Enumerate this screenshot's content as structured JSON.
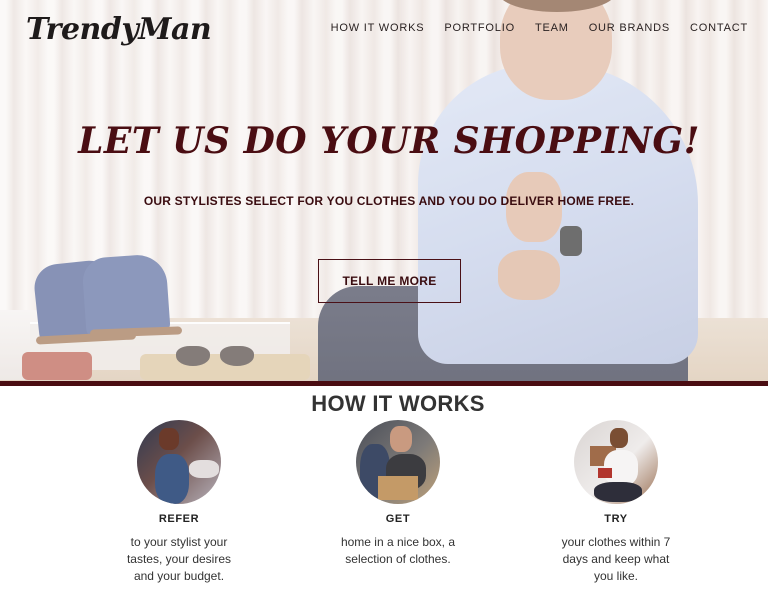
{
  "brand": {
    "logo_text": "TrendyMan"
  },
  "nav": {
    "items": [
      "HOW IT WORKS",
      "PORTFOLIO",
      "TEAM",
      "OUR BRANDS",
      "CONTACT"
    ]
  },
  "hero": {
    "title": "LET US DO YOUR SHOPPING!",
    "subtitle": "OUR STYLISTES SELECT FOR YOU CLOTHES AND YOU DO DELIVER HOME FREE.",
    "cta_label": "TELL ME MORE"
  },
  "how_it_works": {
    "title": "HOW IT WORKS",
    "steps": [
      {
        "title": "REFER",
        "text": "to your stylist your tastes, your desires and your budget."
      },
      {
        "title": "GET",
        "text": "home in a nice box, a selection of clothes."
      },
      {
        "title": "TRY",
        "text": "your clothes within 7 days and keep what you like."
      }
    ]
  },
  "colors": {
    "accent": "#4a0d12",
    "text": "#333333",
    "background": "#ffffff"
  }
}
